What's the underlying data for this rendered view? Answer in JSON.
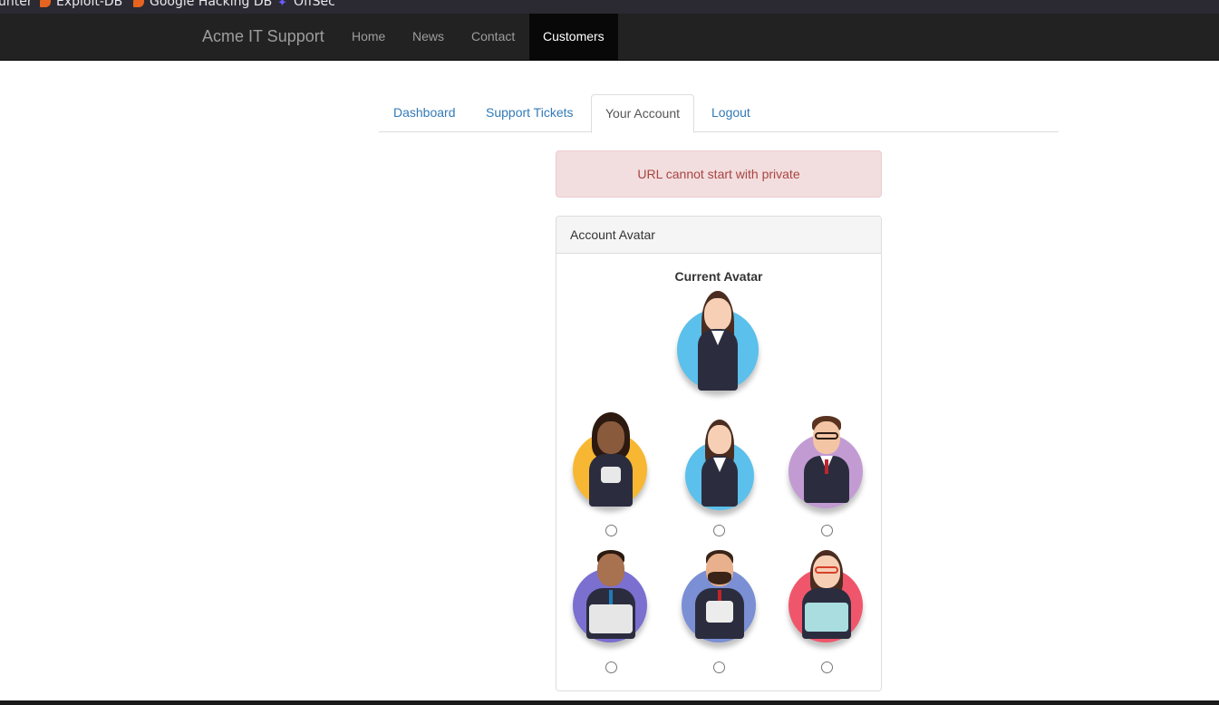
{
  "bookmarks": [
    {
      "label": "unter",
      "icon": "none"
    },
    {
      "label": "Exploit-DB",
      "icon": "exploit-db-icon"
    },
    {
      "label": "Google Hacking DB",
      "icon": "exploit-db-icon"
    },
    {
      "label": "OffSec",
      "icon": "offsec-icon"
    }
  ],
  "navbar": {
    "brand": "Acme IT Support",
    "links": [
      "Home",
      "News",
      "Contact",
      "Customers"
    ],
    "active": "Customers"
  },
  "page": {
    "heading": "Your Account"
  },
  "tabs": {
    "items": [
      "Dashboard",
      "Support Tickets",
      "Your Account",
      "Logout"
    ],
    "active": "Your Account"
  },
  "alert": {
    "message": "URL cannot start with private",
    "color": "#a94442"
  },
  "panel": {
    "title": "Account Avatar",
    "current_avatar_label": "Current Avatar",
    "current_avatar": "avatar-2",
    "avatars": [
      {
        "name": "avatar-1",
        "color": "#f7b733"
      },
      {
        "name": "avatar-2",
        "color": "#5bc0eb"
      },
      {
        "name": "avatar-3",
        "color": "#c39bd3"
      },
      {
        "name": "avatar-4",
        "color": "#7b6fd0"
      },
      {
        "name": "avatar-5",
        "color": "#7a8fd4"
      },
      {
        "name": "avatar-6",
        "color": "#f0566b"
      }
    ]
  },
  "colors": {
    "link": "#337ab7",
    "navbar_bg": "#222222",
    "alert_bg": "#f2dede"
  }
}
